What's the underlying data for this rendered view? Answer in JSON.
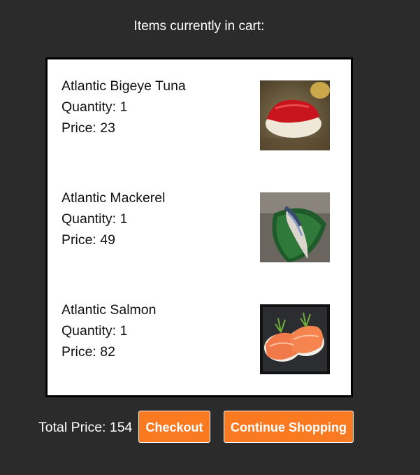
{
  "heading": "Items currently in cart:",
  "cart": {
    "items": [
      {
        "name": "Atlantic Bigeye Tuna",
        "quantity": "Quantity: 1",
        "price": "Price: 23",
        "image_icon": "tuna-sushi-image"
      },
      {
        "name": "Atlantic Mackerel",
        "quantity": "Quantity: 1",
        "price": "Price: 49",
        "image_icon": "mackerel-sushi-image"
      },
      {
        "name": "Atlantic Salmon",
        "quantity": "Quantity: 1",
        "price": "Price: 82",
        "image_icon": "salmon-sushi-image"
      }
    ]
  },
  "footer": {
    "total_label": "Total Price: 154",
    "checkout_label": "Checkout",
    "continue_label": "Continue Shopping"
  },
  "colors": {
    "background": "#2b2b2b",
    "button": "#fa7a22",
    "cart_bg": "#ffffff"
  }
}
